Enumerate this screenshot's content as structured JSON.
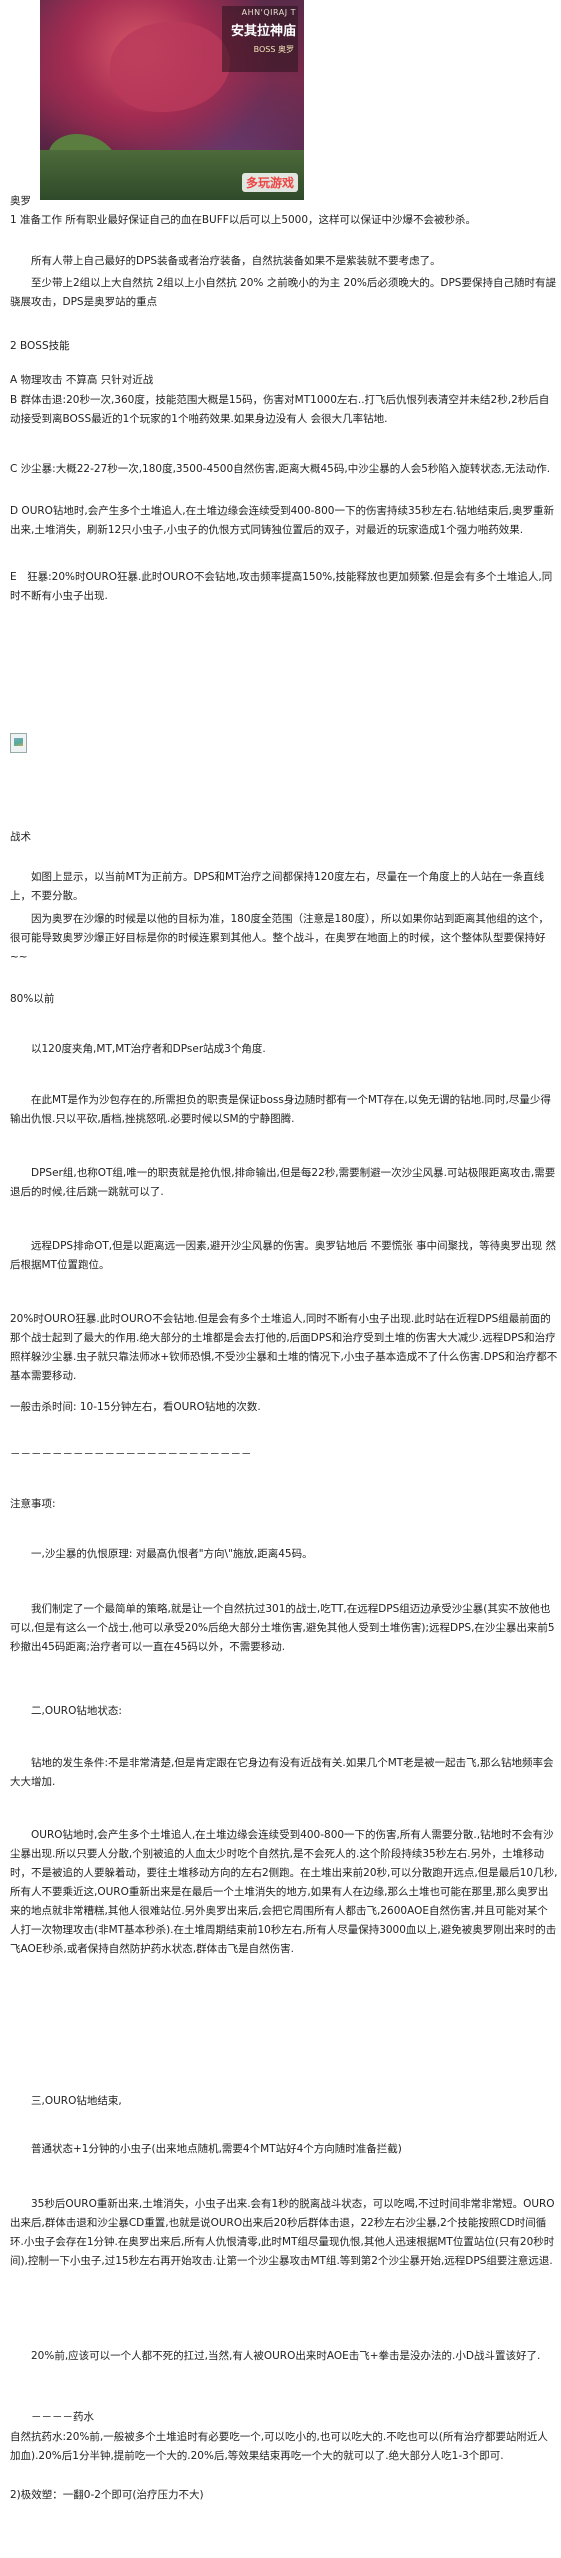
{
  "hero": {
    "subtitle": "AHN'QIRAJ T",
    "title": "安其拉神庙",
    "boss": "BOSS 奥罗",
    "watermark": "多玩游戏"
  },
  "text": {
    "p01": "奥罗",
    "p02": "1 准备工作 所有职业最好保证自己的血在BUFF以后可以上5000，这样可以保证中沙爆不会被秒杀。",
    "p03": "所有人带上自己最好的DPS装备或者治疗装备，自然抗装备如果不是紫装就不要考虑了。",
    "p04": "至少带上2组以上大自然抗 2组以上小自然抗 20% 之前晚小的为主 20%后必须晚大的。DPS要保持自己随时有諟骁展攻击，DPS是奥罗站的重点",
    "p05": "2 BOSS技能",
    "p06": "A 物理攻击 不算高 只针对近战",
    "p07": "B 群体击退:20秒一次,360度，技能范围大概是15码，伤害对MT1000左右..打飞后仇恨列表清空并未结2秒,2秒后自动接受到离BOSS最近的1个玩家的1个啪药效果.如果身边没有人 会很大几率钻地.",
    "p08": "C 沙尘暴:大概22-27秒一次,180度,3500-4500自然伤害,距离大概45码,中沙尘暴的人会5秒陷入旋转状态,无法动作.",
    "p09": "D OURO钻地时,会产生多个土堆追人,在土堆边缘会连续受到400-800一下的伤害持续35秒左右.钻地结束后,奥罗重新出来,土堆消失，刷新12只小虫子,小虫子的仇恨方式同铸独位置后的双子，对最近的玩家造成1个强力啪药效果.",
    "p10": "E　狂暴:20%时OURO狂暴.此时OURO不会钻地,攻击频率提高150%,技能释放也更加频繁.但是会有多个土堆追人,同时不断有小虫子出现.",
    "p11": "战术",
    "p12": "如图上显示，以当前MT为正前方。DPS和MT治疗之间都保持120度左右，尽量在一个角度上的人站在一条直线上，不要分散。",
    "p13": "因为奥罗在沙爆的时候是以他的目标为准，180度全范围（注意是180度），所以如果你站到距离其他组的这个，很可能导致奥罗沙爆正好目标是你的时候连累到其他人。整个战斗，在奥罗在地面上的时候，这个整体队型要保持好~~",
    "p14": "80%以前",
    "p15": "以120度夹角,MT,MT治疗者和DPser站成3个角度.",
    "p16": "在此MT是作为沙包存在的,所需担负的职责是保证boss身边随时都有一个MT存在,以免无谓的钻地.同时,尽量少得输出仇恨.只以平砍,盾档,挫挑怒吼.必要时候以SM的宁静图腾.",
    "p17": "DPSer组,也称OT组,唯一的职责就是抢仇恨,排命输出,但是每22秒,需要制避一次沙尘风暴.可站极限距离攻击,需要退后的时候,往后跳一跳就可以了.",
    "p18": "远程DPS排命OT,但是以距离远一因素,避开沙尘风暴的伤害。奥罗钻地后 不要慌张 事中间聚找，等待奥罗出现 然后根据MT位置跑位。",
    "p19": "20%时OURO狂暴.此时OURO不会钻地.但是会有多个土堆追人,同时不断有小虫子出现.此时站在近程DPS组最前面的那个战士起到了最大的作用.绝大部分的土堆都是会去打他的,后面DPS和治疗受到土堆的伤害大大减少.远程DPS和治疗照样躲沙尘暴.虫子就只靠法师冰+钦师恐惧,不受沙尘暴和土堆的情况下,小虫子基本造成不了什么伤害.DPS和治疗都不基本需要移动.",
    "p20": "一般击杀时间: 10-15分钟左右，看OURO钻地的次数.",
    "p21": "－－－－－－－－－－－－－－－－－－－－－－－",
    "p22": "注意事项:",
    "p23": "一,沙尘暴的仇恨原理: 对最高仇恨者\"方向\\\"施放,距离45码。",
    "p24": "我们制定了一个最简单的策略,就是让一个自然抗过301的战士,吃TT,在远程DPS组迈边承受沙尘暴(其实不放他也可以,但是有这么一个战士,他可以承受20%后绝大部分土堆伤害,避免其他人受到土堆伤害);远程DPS,在沙尘暴出来前5秒撤出45码距离;治疗者可以一直在45码以外，不需要移动.",
    "p25": "二,OURO钻地状态:",
    "p26": "钻地的发生条件:不是非常清楚,但是肯定跟在它身边有没有近战有关.如果几个MT老是被一起击飞,那么钻地频率会大大增加.",
    "p27": "OURO钻地时,会产生多个土堆追人,在土堆边缘会连续受到400-800一下的伤害,所有人需要分散.,钻地时不会有沙尘暴出现.所以只要人分散,个别被追的人血太少时吃个自然抗,是不会死人的.这个阶段持续35秒左右.另外，土堆移动时，不是被追的人要躲着动，要往土堆移动方向的左右2侧跑。在土堆出来前20秒,可以分散跑开远点,但是最后10几秒,所有人不要乘近这,OURO重新出来是在最后一个土堆消失的地方,如果有人在边缘,那么土堆也可能在那里,那么奥罗出来的地点就非常糟糕,其他人很难站位.另外奥罗出来后,会把它周围所有人都击飞,2600AOE自然伤害,并且可能对某个人打一次物理攻击(非MT基本秒杀).在土堆周期结束前10秒左右,所有人尽量保持3000血以上,避免被奥罗刚出来时的击飞AOE秒杀,或者保持自然防护药水状态,群体击飞是自然伤害.",
    "p28": "三,OURO钻地结束,",
    "p29": "普通状态+1分钟的小虫子(出来地点随机,需要4个MT站好4个方向随时准备拦截)",
    "p30": "35秒后OURO重新出来,土堆消失，小虫子出来.会有1秒的脱离战斗状态，可以吃喝,不过时间非常非常短。OURO出来后,群体击退和沙尘暴CD重置,也就是说OURO出来后20秒后群体击退，22秒左右沙尘暴,2个技能按照CD时间循环.小虫子会存在1分钟.在奥罗出来后,所有人仇恨清零,此时MT组尽量现仇恨,其他人迅速根据MT位置站位(只有20秒时间),控制一下小虫子,过15秒左右再开始攻击.让第一个沙尘暴攻击MT组.等到第2个沙尘暴开始,远程DPS组要注意远退.",
    "p31": "20%前,应该可以一个人都不死的扛过,当然,有人被OURO出来时AOE击飞+拳击是没办法的.小D战斗置该好了.",
    "p32": "－－－－药水",
    "p33": "自然抗药水:20%前,一般被多个土堆追时有必要吃一个,可以吃小的,也可以吃大的.不吃也可以(所有治疗都要站附近人加血).20%后1分半钟,提前吃一个大的.20%后,等效果结束再吃一个大的就可以了.绝大部分人吃1-3个即可.",
    "p34": "2)极效塑：一翻0-2个即可(治疗压力不大)"
  }
}
